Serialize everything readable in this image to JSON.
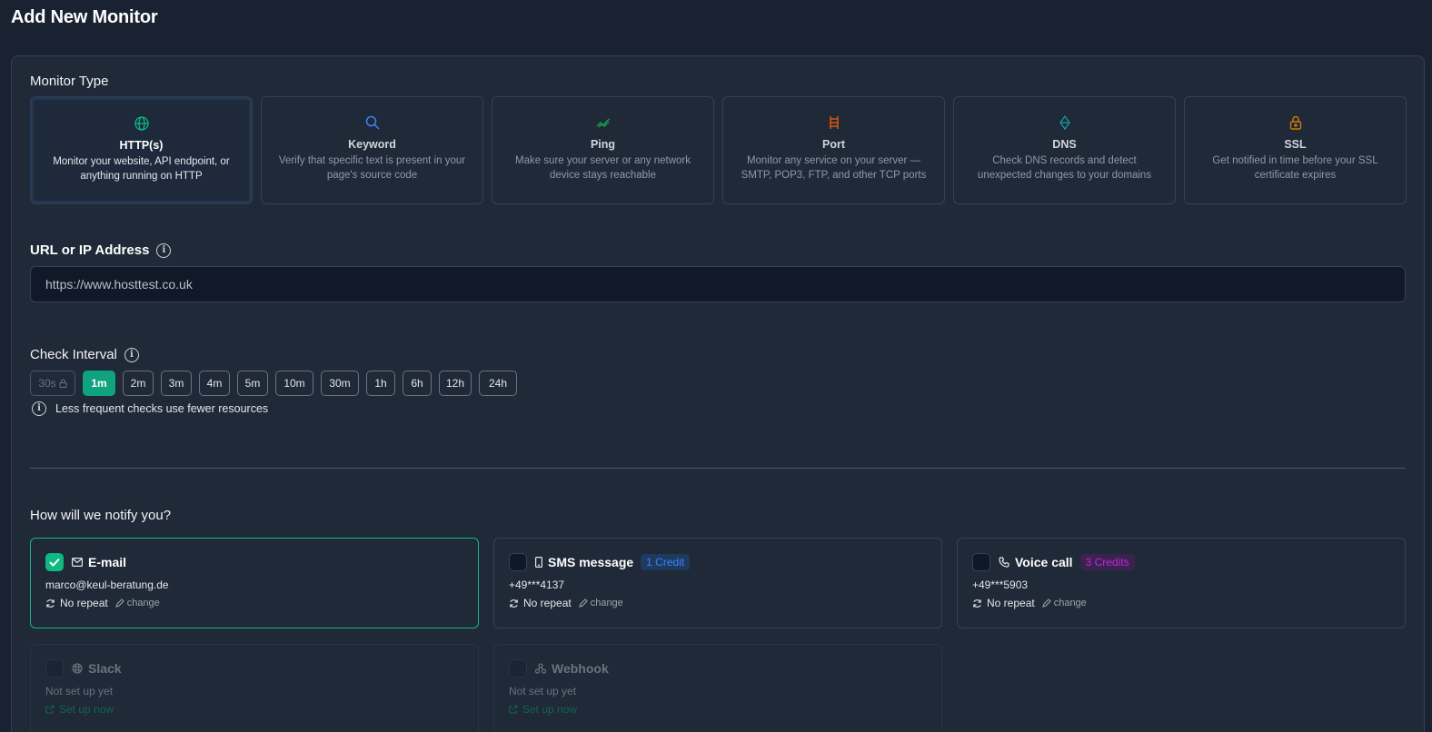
{
  "page": {
    "title": "Add New Monitor"
  },
  "monitor_type": {
    "label": "Monitor Type",
    "types": [
      {
        "name": "HTTP(s)",
        "desc": "Monitor your website, API endpoint, or anything running on HTTP",
        "icon": "globe-icon",
        "color": "#10b981",
        "selected": true
      },
      {
        "name": "Keyword",
        "desc": "Verify that specific text is present in your page's source code",
        "icon": "search-icon",
        "color": "#3b82f6",
        "selected": false
      },
      {
        "name": "Ping",
        "desc": "Make sure your server or any network device stays reachable",
        "icon": "pulse-icon",
        "color": "#16a34a",
        "selected": false
      },
      {
        "name": "Port",
        "desc": "Monitor any service on your server — SMTP, POP3, FTP, and other TCP ports",
        "icon": "ladder-icon",
        "color": "#ea580c",
        "selected": false
      },
      {
        "name": "DNS",
        "desc": "Check DNS records and detect unexpected changes to your domains",
        "icon": "diamond-icon",
        "color": "#0e9f9f",
        "selected": false
      },
      {
        "name": "SSL",
        "desc": "Get notified in time before your SSL certificate expires",
        "icon": "lock-icon",
        "color": "#d97706",
        "selected": false
      }
    ]
  },
  "url": {
    "label": "URL or IP Address",
    "value": "https://www.hosttest.co.uk",
    "info": "i"
  },
  "interval": {
    "label": "Check Interval",
    "options": [
      "30s",
      "1m",
      "2m",
      "3m",
      "4m",
      "5m",
      "10m",
      "30m",
      "1h",
      "6h",
      "12h",
      "24h"
    ],
    "selected": "1m",
    "locked": "30s",
    "hint": "Less frequent checks use fewer resources"
  },
  "notify": {
    "label": "How will we notify you?",
    "channels": [
      {
        "name": "E-mail",
        "detail": "marco@keul-beratung.de",
        "repeat": "No repeat",
        "change": "change",
        "checked": true
      },
      {
        "name": "SMS message",
        "badge": "1 Credit",
        "detail": "+49***4137",
        "repeat": "No repeat",
        "change": "change",
        "checked": false
      },
      {
        "name": "Voice call",
        "badge": "3 Credits",
        "detail": "+49***5903",
        "repeat": "No repeat",
        "change": "change",
        "checked": false
      },
      {
        "name": "Slack",
        "detail": "Not set up yet",
        "setup": "Set up now",
        "checked": false
      },
      {
        "name": "Webhook",
        "detail": "Not set up yet",
        "setup": "Set up now",
        "checked": false
      }
    ]
  }
}
